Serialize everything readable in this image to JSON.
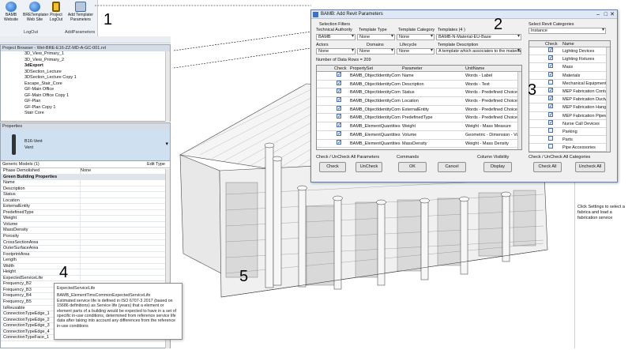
{
  "ribbon": {
    "buttons": [
      {
        "label": "BAMB\nWebsite",
        "icon": "globe-icon"
      },
      {
        "label": "BRETemplater\nWeb Site",
        "icon": "globe-icon"
      },
      {
        "label": "Project\nLogOut",
        "icon": "lock-icon"
      },
      {
        "label": "Add Templater\nParameters",
        "icon": "gear-icon"
      }
    ],
    "groups": [
      "LogOut",
      "AddParameters"
    ]
  },
  "project_browser": {
    "title": "Project Browser - Wel-BRE-E16-ZZ-MD-A-GC-001.rvt",
    "items": [
      "3D_View_Primary_1",
      "3D_View_Primary_2",
      "3dExport",
      "3DSection_Lecture",
      "3DSection_Lecture Copy 1",
      "Escape_Stair_Core",
      "GF-Main Office",
      "GF-Main Office Copy 1",
      "GF-Plan",
      "GF-Plan Copy 1",
      "Stair Core"
    ]
  },
  "properties": {
    "title": "Properties",
    "type_name": "B16-Vent",
    "type_sub": "Vent",
    "category": "Generic Models (1)",
    "edit_type": "Edit Type",
    "rows": [
      "Phase Demolished",
      "Green Building Properties",
      "Name",
      "Description",
      "Status",
      "Location",
      "ExternalEntity",
      "PredefinedType",
      "Weight",
      "Volume",
      "MassDensity",
      "Porosity",
      "CrossSectionArea",
      "OuterSurfaceArea",
      "FootprintArea",
      "Length",
      "Width",
      "Height",
      "ExpectedServiceLife",
      "Frequency_B2",
      "Frequency_B3",
      "Frequency_B4",
      "Frequency_B5",
      "IsReusable",
      "ConnectionTypeEdge_1",
      "ConnectionTypeEdge_2",
      "ConnectionTypeEdge_3",
      "ConnectionTypeEdge_4",
      "ConnectionTypeFace_1"
    ],
    "phase_value": "None"
  },
  "tooltip": {
    "title": "ExpectedServiceLife",
    "param": "BAMB_ElementTimsCommonExpectedServiceLife",
    "body": "Estimated service life is defined in ISO 6707-3 2017 (based on 15686 definitions) as Service life (years) that a element or element parts of a building would be expected to have in a set of specific in-use conditions, determined from reference service life data after taking into account any differences from the reference in-use conditions"
  },
  "dialog": {
    "title": "BAMB: Add Revit Parameters",
    "selection_filters": "Selection Filters",
    "technical_authority_label": "Technical Authority",
    "template_type_label": "Template Type",
    "template_category_label": "Template Category",
    "templates_label": "Templates (4 )",
    "technical_authority_value": "BAMB",
    "template_type_value": "None",
    "template_category_value": "None",
    "templates_value": "BAMB-N-Material-EU-Base",
    "actors_label": "Actors",
    "domains_label": "Domains",
    "lifecycle_label": "Lifecycle",
    "template_description_label": "Template Description",
    "actors_value": "None",
    "domains_value": "None",
    "lifecycle_value": "None",
    "template_description_value": "A template which associates to the materiality and",
    "rows_count": "Number of Data Rows = 209",
    "columns": [
      "Check",
      "PropertySet",
      "Parameter",
      "UnitName"
    ],
    "rows": [
      {
        "pset": "BAMB_ObjectIdentityCommon",
        "param": "Name",
        "unit": "Words - Label"
      },
      {
        "pset": "BAMB_ObjectIdentityCommon",
        "param": "Description",
        "unit": "Words - Text"
      },
      {
        "pset": "BAMB_ObjectIdentityCommon",
        "param": "Status",
        "unit": "Words - Predefined Choice List (s"
      },
      {
        "pset": "BAMB_ObjectIdentityCommon",
        "param": "Location",
        "unit": "Words - Predefined Choice List (s"
      },
      {
        "pset": "BAMB_ObjectIdentityCommon",
        "param": "ExternalEntity",
        "unit": "Words - Predefined Choice Class"
      },
      {
        "pset": "BAMB_ObjectIdentityCommon",
        "param": "PredefinedType",
        "unit": "Words - Predefined Choice List (s"
      },
      {
        "pset": "BAMB_ElementQuantities",
        "param": "Weight",
        "unit": "Weight - Mass Measure"
      },
      {
        "pset": "BAMB_ElementQuantities",
        "param": "Volume",
        "unit": "Geometric - Dimension - Volume"
      },
      {
        "pset": "BAMB_ElementQuantities",
        "param": "MassDensity",
        "unit": "Weight - Mass Density"
      }
    ],
    "left_footer": "Check / UnCheck All Parameters",
    "commands_label": "Commands",
    "visibility_label": "Column Visibility",
    "btn_check": "Check",
    "btn_uncheck": "UnCheck",
    "btn_ok": "OK",
    "btn_cancel": "Cancel",
    "btn_display": "Display",
    "categories_label": "Select Revit Categories",
    "categories_combo": "Instance",
    "cat_columns": [
      "Check",
      "Name"
    ],
    "categories": [
      {
        "name": "Lighting Devices",
        "checked": true
      },
      {
        "name": "Lighting Fixtures",
        "checked": true
      },
      {
        "name": "Mass",
        "checked": true
      },
      {
        "name": "Materials",
        "checked": true
      },
      {
        "name": "Mechanical Equipment",
        "checked": false
      },
      {
        "name": "MEP Fabrication Containment",
        "checked": true
      },
      {
        "name": "MEP Fabrication Ductwork",
        "checked": true
      },
      {
        "name": "MEP Fabrication Hangers",
        "checked": true
      },
      {
        "name": "MEP Fabrication Pipework",
        "checked": true
      },
      {
        "name": "Nurse Call Devices",
        "checked": true
      },
      {
        "name": "Parking",
        "checked": false
      },
      {
        "name": "Parts",
        "checked": false
      },
      {
        "name": "Pipe Accessories",
        "checked": false
      }
    ],
    "right_footer": "Check / UnCheck All Categories",
    "btn_check_all": "Check All",
    "btn_uncheck_all": "Uncheck All"
  },
  "right_panel_text": "Click Settings to select a fabrica and load a fabrication service",
  "callouts": [
    "1",
    "2",
    "3",
    "4",
    "5"
  ],
  "colors": {
    "accent": "#2f5fa8",
    "selection": "#cfe0f1"
  }
}
